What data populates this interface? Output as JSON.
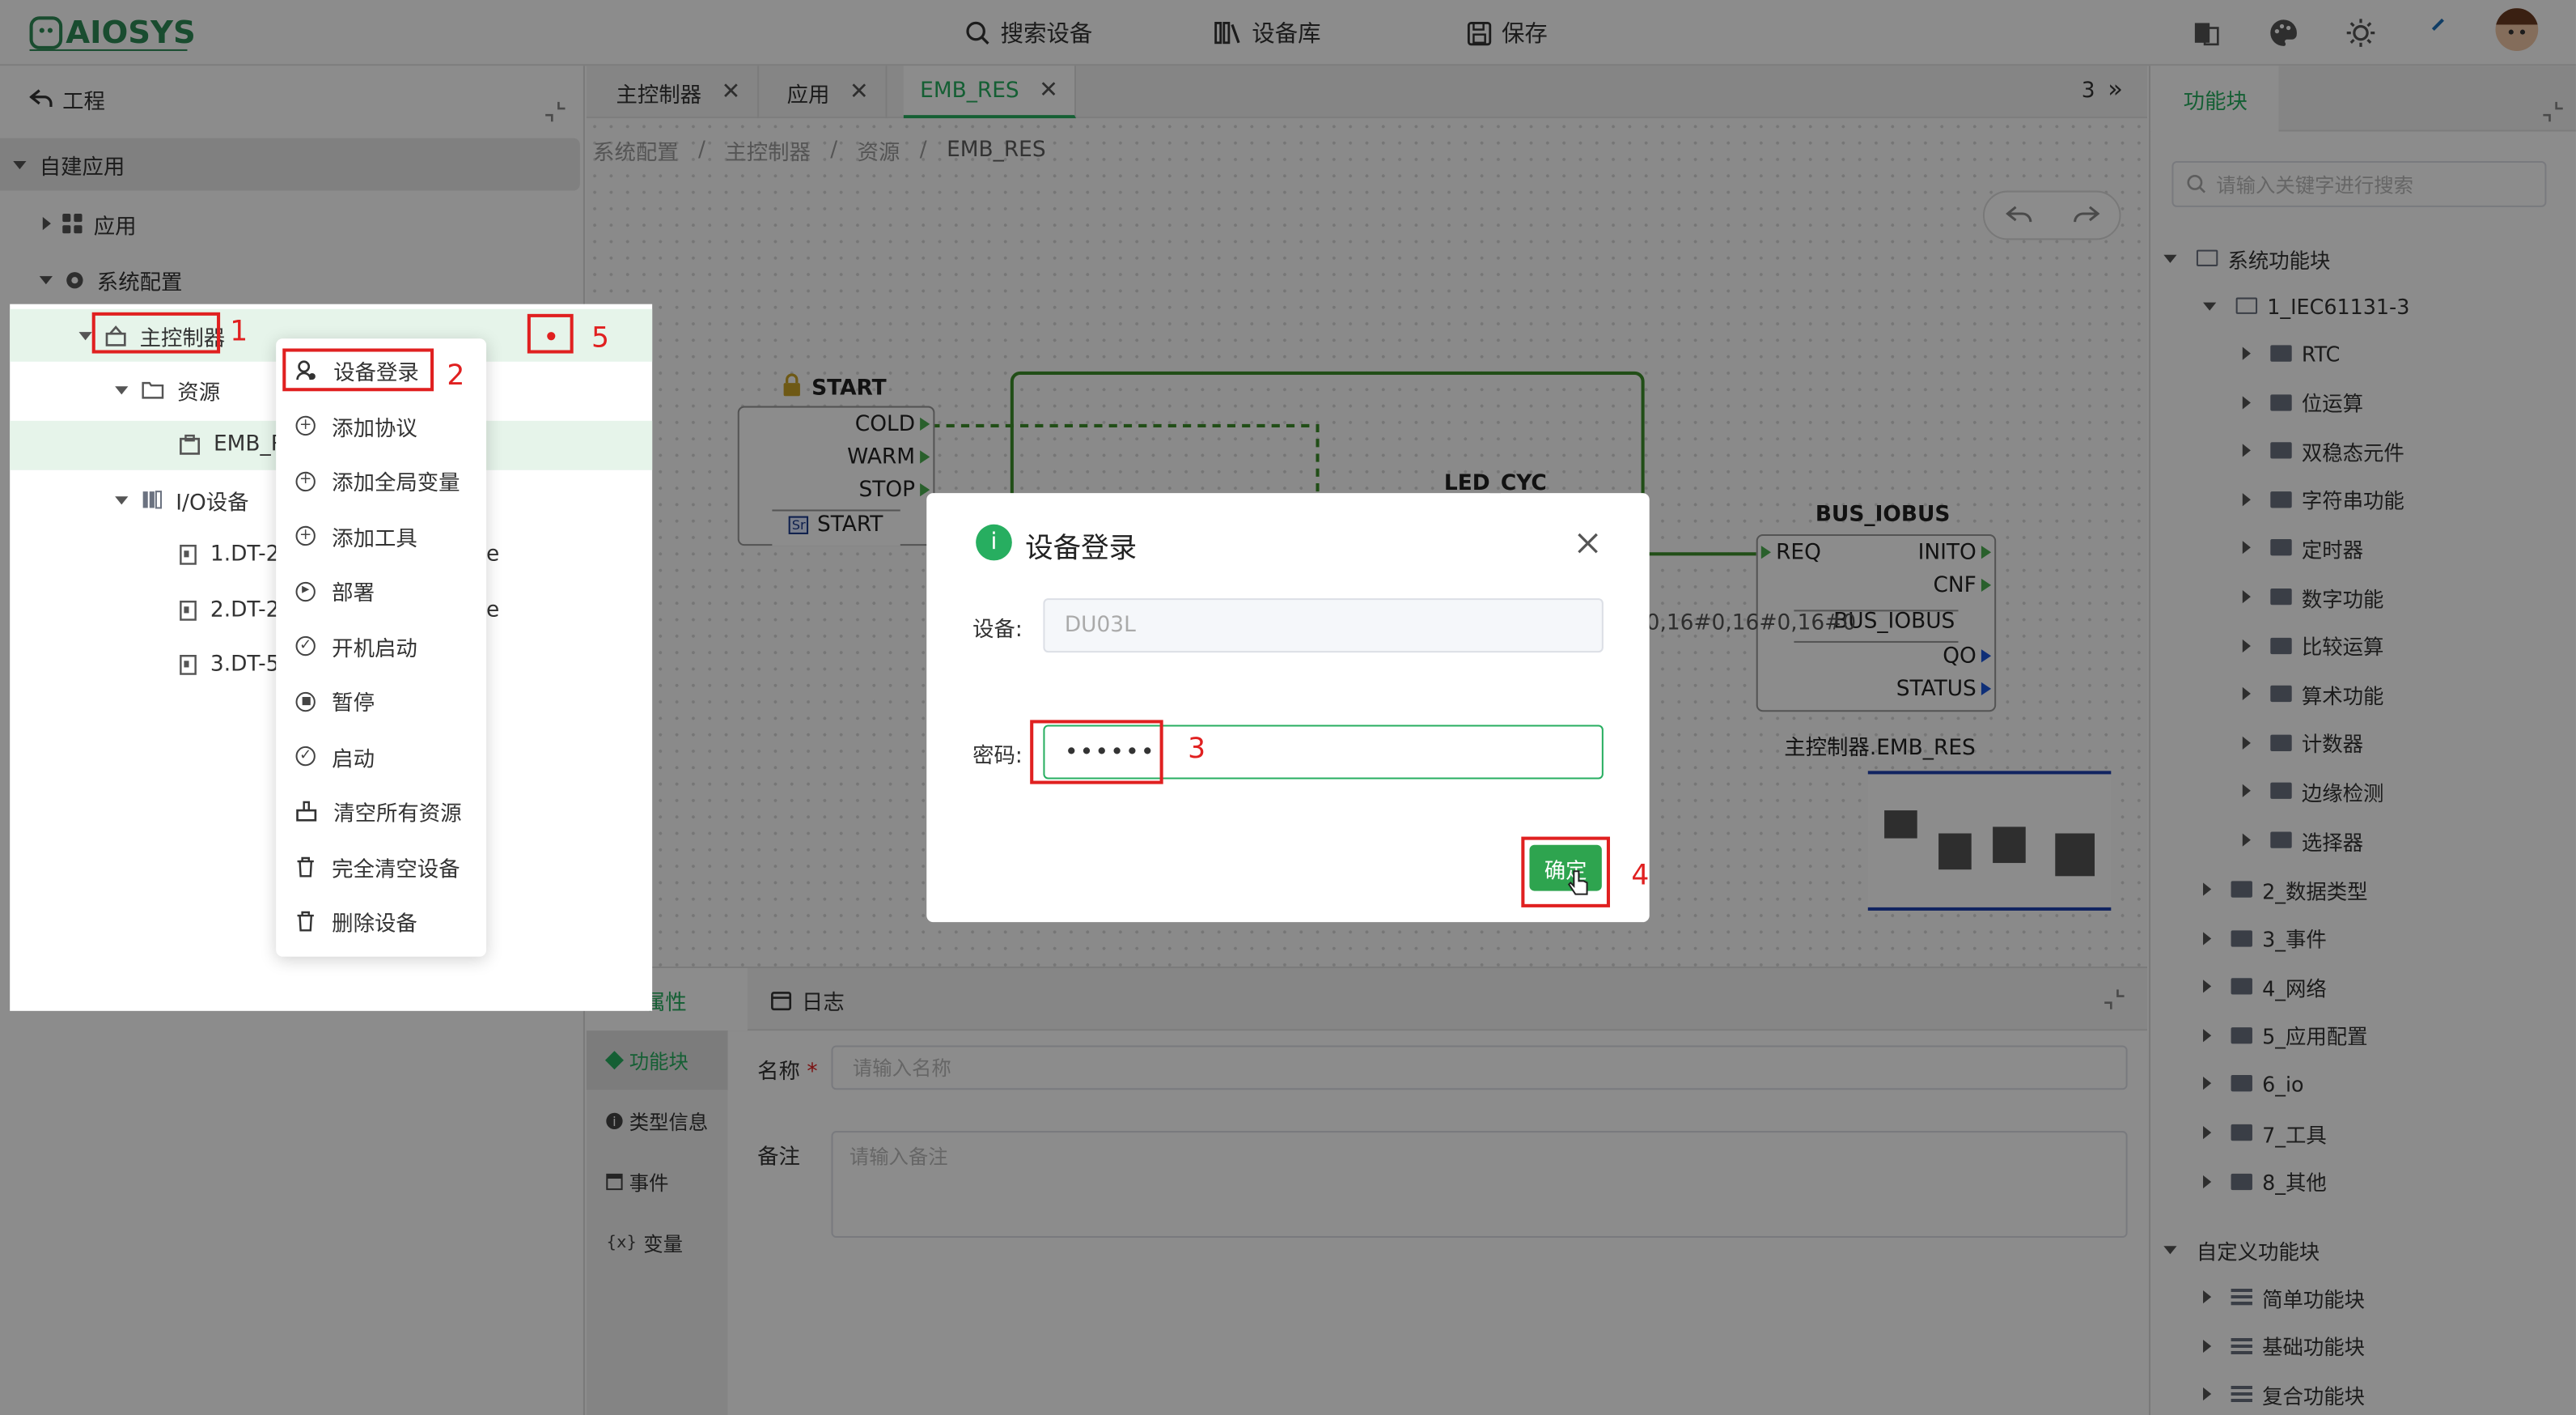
{
  "topbar": {
    "logo": "AIOSYS",
    "nav": [
      {
        "label": "搜索设备",
        "icon": "search-icon"
      },
      {
        "label": "设备库",
        "icon": "library-icon"
      },
      {
        "label": "保存",
        "icon": "save-icon"
      }
    ]
  },
  "left": {
    "header": "工程",
    "root": "自建应用",
    "items": [
      {
        "label": "应用",
        "icon": "grid-icon"
      },
      {
        "label": "系统配置",
        "icon": "gear-icon"
      },
      {
        "label": "主控制器",
        "icon": "controller-icon"
      },
      {
        "label": "资源",
        "icon": "folder-icon"
      },
      {
        "label": "EMB_R",
        "icon": "resource-icon"
      },
      {
        "label": "I/O设备",
        "icon": "io-icon"
      },
      {
        "label": "1.DT-2",
        "icon": "module-icon"
      },
      {
        "label": "2.DT-2",
        "icon": "module-icon"
      },
      {
        "label": "3.DT-5",
        "icon": "module-icon"
      }
    ],
    "clipped_suffix": "e"
  },
  "tabs": {
    "items": [
      "主控制器",
      "应用",
      "EMB_RES"
    ],
    "count": "3",
    "more": "»"
  },
  "breadcrumb": [
    "系统配置",
    "主控制器",
    "资源",
    "EMB_RES"
  ],
  "breadcrumb_sep": "/",
  "canvas": {
    "start": {
      "title": "START",
      "ports": [
        "COLD",
        "WARM",
        "STOP"
      ],
      "footer": "START",
      "footer_icon": "Sr"
    },
    "led": {
      "title": "LED_CYC"
    },
    "bus": {
      "title": "BUS_IOBUS",
      "left_port": "REQ",
      "right_ports": [
        "INITO",
        "CNF"
      ],
      "middle": "BUS_IOBUS",
      "outputs": [
        "QO",
        "STATUS"
      ],
      "caption": "主控制器.EMB_RES"
    },
    "param_text": "0,16#0,16#0,16#0"
  },
  "bottom": {
    "tabs": [
      "属性",
      "日志"
    ],
    "side_tabs": [
      "功能块",
      "类型信息",
      "事件",
      "变量"
    ],
    "name_label": "名称",
    "name_required": "*",
    "name_placeholder": "请输入名称",
    "note_label": "备注",
    "note_placeholder": "请输入备注"
  },
  "right": {
    "tab": "功能块",
    "search_placeholder": "请输入关键字进行搜索",
    "root": "系统功能块",
    "group": "1_IEC61131-3",
    "subitems": [
      "RTC",
      "位运算",
      "双稳态元件",
      "字符串功能",
      "定时器",
      "数字功能",
      "比较运算",
      "算术功能",
      "计数器",
      "边缘检测",
      "选择器"
    ],
    "others": [
      "2_数据类型",
      "3_事件",
      "4_网络",
      "5_应用配置",
      "6_io",
      "7_工具",
      "8_其他"
    ],
    "custom_root": "自定义功能块",
    "custom_items": [
      "简单功能块",
      "基础功能块",
      "复合功能块"
    ]
  },
  "context_menu": {
    "items": [
      {
        "label": "设备登录",
        "icon": "user-login-icon"
      },
      {
        "label": "添加协议",
        "icon": "plus-circle-icon"
      },
      {
        "label": "添加全局变量",
        "icon": "plus-circle-icon"
      },
      {
        "label": "添加工具",
        "icon": "plus-circle-icon"
      },
      {
        "label": "部署",
        "icon": "play-circle-icon"
      },
      {
        "label": "开机启动",
        "icon": "check-circle-icon"
      },
      {
        "label": "暂停",
        "icon": "stop-circle-icon"
      },
      {
        "label": "启动",
        "icon": "check-circle-icon"
      },
      {
        "label": "清空所有资源",
        "icon": "clear-icon"
      },
      {
        "label": "完全清空设备",
        "icon": "trash-icon"
      },
      {
        "label": "删除设备",
        "icon": "trash-icon"
      }
    ]
  },
  "dialog": {
    "title": "设备登录",
    "device_label": "设备:",
    "device_value": "DU03L",
    "password_label": "密码:",
    "password_value": "••••••",
    "confirm": "确定"
  },
  "annotations": [
    "1",
    "2",
    "3",
    "4",
    "5"
  ],
  "colors": {
    "accent": "#27ae60",
    "annotation": "#e02020",
    "confirm": "#2ea44f"
  }
}
